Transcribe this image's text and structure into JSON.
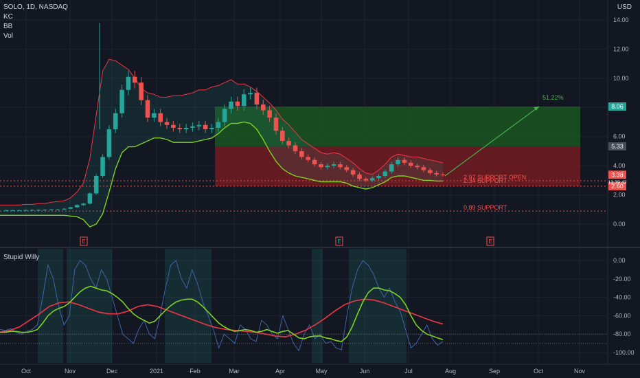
{
  "header": {
    "symbol": "SOLO, 1D, NASDAQ",
    "indicators": [
      "KC",
      "BB",
      "Vol"
    ],
    "currency": "USD"
  },
  "lower_pane": {
    "title": "Stupid Willy"
  },
  "colors": {
    "background": "#131722",
    "grid": "#1e2330",
    "up": "#26a69a",
    "down": "#ef5350",
    "green_line": "#4caf50",
    "red_line": "#f23645",
    "blue_line": "#3f63a8",
    "profit_zone": "#1b5e20",
    "loss_zone": "#7f1d21"
  },
  "chart_data": [
    {
      "type": "line",
      "name": "price",
      "title": "SOLO, 1D, NASDAQ",
      "y_axis_ticks": [
        14.0,
        12.0,
        10.0,
        8.0,
        6.0,
        4.0,
        2.0,
        0.0
      ],
      "ylim": [
        -0.4,
        15.2
      ],
      "x_labels": [
        "Oct",
        "Nov",
        "Dec",
        "2021",
        "Feb",
        "Mar",
        "Apr",
        "May",
        "Jun",
        "Jul",
        "Aug",
        "Sep",
        "Oct",
        "Nov"
      ],
      "price_badges": [
        {
          "label": "8.06",
          "value": 8.06,
          "color": "#26a69a"
        },
        {
          "label": "5.33",
          "value": 5.33,
          "color": "#4a4e5a"
        },
        {
          "label": "3.38",
          "value": 3.38,
          "color": "#ef5350"
        },
        {
          "label": "2.60",
          "value": 2.6,
          "color": "#ef5350"
        }
      ],
      "current_price_countdown": "13:39:42",
      "support_lines": [
        {
          "label": "2.97 SUPPORT OPEN",
          "value": 2.97
        },
        {
          "label": "2.34 SUPPORT",
          "value": 2.6
        },
        {
          "label": "0.89 SUPPORT",
          "value": 0.89
        }
      ],
      "target_percent": "51.22%",
      "position": {
        "entry": 5.33,
        "target": 8.06,
        "stop": 2.6
      },
      "earnings_markers": [
        "E",
        "E",
        "E"
      ],
      "close_series": [
        0.95,
        0.95,
        0.95,
        0.95,
        0.96,
        0.97,
        0.97,
        0.98,
        1.0,
        1.0,
        1.05,
        1.15,
        1.3,
        1.4,
        2.1,
        3.3,
        4.6,
        6.5,
        7.6,
        9.2,
        10.1,
        9.7,
        8.5,
        7.3,
        7.6,
        7.0,
        6.8,
        6.6,
        6.5,
        6.6,
        6.7,
        6.8,
        6.5,
        6.6,
        7.0,
        7.9,
        8.4,
        8.1,
        8.9,
        9.0,
        8.2,
        7.8,
        7.3,
        6.4,
        5.7,
        5.4,
        5.0,
        4.6,
        4.4,
        4.1,
        3.9,
        4.0,
        4.1,
        3.9,
        3.7,
        3.4,
        3.1,
        3.0,
        3.15,
        3.3,
        3.6,
        4.1,
        4.4,
        4.2,
        4.0,
        3.9,
        3.7,
        3.5,
        3.4,
        3.38
      ],
      "upper_band": [
        1.3,
        1.3,
        1.3,
        1.3,
        1.35,
        1.35,
        1.4,
        1.4,
        1.5,
        1.55,
        1.6,
        1.8,
        2.2,
        2.8,
        4.5,
        7.5,
        10.5,
        11.3,
        11.2,
        10.9,
        10.6,
        10.0,
        9.3,
        9.0,
        8.9,
        8.7,
        8.7,
        8.8,
        8.8,
        8.9,
        9.0,
        9.2,
        9.2,
        9.4,
        9.5,
        9.7,
        9.9,
        9.6,
        9.6,
        9.4,
        9.1,
        8.7,
        8.3,
        7.8,
        7.2,
        6.8,
        6.3,
        5.8,
        5.5,
        5.2,
        4.9,
        4.8,
        4.9,
        4.8,
        4.5,
        4.2,
        3.8,
        3.5,
        3.4,
        3.7,
        4.1,
        4.6,
        4.8,
        4.7,
        4.6,
        4.6,
        4.5,
        4.4,
        4.3,
        4.2
      ],
      "lower_band": [
        0.6,
        0.6,
        0.6,
        0.6,
        0.6,
        0.6,
        0.6,
        0.6,
        0.6,
        0.6,
        0.6,
        0.55,
        0.5,
        0.3,
        -0.2,
        0.0,
        0.7,
        2.2,
        3.8,
        4.9,
        5.3,
        5.3,
        5.5,
        5.7,
        5.9,
        5.9,
        5.8,
        5.6,
        5.6,
        5.6,
        5.6,
        5.7,
        5.8,
        5.9,
        6.2,
        6.6,
        6.9,
        6.9,
        7.0,
        6.9,
        6.5,
        5.8,
        5.0,
        4.3,
        3.8,
        3.5,
        3.3,
        3.2,
        3.1,
        3.0,
        2.9,
        2.9,
        2.9,
        2.9,
        2.8,
        2.6,
        2.5,
        2.4,
        2.5,
        2.7,
        2.9,
        3.2,
        3.3,
        3.3,
        3.2,
        3.1,
        3.0,
        3.0,
        2.95,
        2.95
      ]
    },
    {
      "type": "line",
      "name": "oscillator",
      "title": "Stupid Willy",
      "y_axis_ticks": [
        0.0,
        -20.0,
        -40.0,
        -60.0,
        -80.0,
        -100.0
      ],
      "ylim": [
        -103,
        3
      ],
      "x_labels": [
        "Oct",
        "Nov",
        "Dec",
        "2021",
        "Feb",
        "Mar",
        "Apr",
        "May",
        "Jun",
        "Jul",
        "Aug",
        "Sep",
        "Oct",
        "Nov"
      ],
      "fast_series": [
        -75,
        -76,
        -74,
        -78,
        -80,
        -77,
        -75,
        -70,
        -40,
        -5,
        -20,
        -50,
        -70,
        -60,
        -10,
        0,
        -5,
        -20,
        -30,
        -10,
        -20,
        -40,
        -60,
        -80,
        -85,
        -90,
        -75,
        -65,
        -80,
        -85,
        -60,
        -30,
        -5,
        0,
        -20,
        -30,
        -10,
        -25,
        -45,
        -60,
        -75,
        -95,
        -80,
        -85,
        -90,
        -70,
        -75,
        -85,
        -88,
        -65,
        -70,
        -80,
        -85,
        -60,
        -75,
        -90,
        -98,
        -80,
        -70,
        -85,
        -80,
        -90,
        -88,
        -95,
        -97,
        -60,
        -30,
        -10,
        0,
        -5,
        -15,
        -30,
        -40,
        -30,
        -45,
        -55,
        -75,
        -95,
        -90,
        -80,
        -70,
        -85,
        -92,
        -88
      ],
      "signal_series": [
        -78,
        -78,
        -77,
        -77,
        -78,
        -78,
        -77,
        -75,
        -68,
        -60,
        -55,
        -52,
        -50,
        -46,
        -40,
        -34,
        -30,
        -28,
        -30,
        -32,
        -33,
        -36,
        -40,
        -45,
        -52,
        -58,
        -62,
        -65,
        -68,
        -66,
        -60,
        -54,
        -49,
        -45,
        -43,
        -42,
        -42,
        -45,
        -50,
        -56,
        -62,
        -68,
        -72,
        -75,
        -77,
        -76,
        -75,
        -76,
        -78,
        -77,
        -75,
        -77,
        -79,
        -77,
        -76,
        -80,
        -84,
        -85,
        -83,
        -82,
        -82,
        -84,
        -85,
        -87,
        -88,
        -83,
        -72,
        -58,
        -45,
        -35,
        -30,
        -30,
        -32,
        -33,
        -36,
        -40,
        -48,
        -60,
        -70,
        -76,
        -80,
        -82,
        -84,
        -86
      ],
      "trend_series": [
        -78,
        -76,
        -72,
        -65,
        -58,
        -50,
        -46,
        -45,
        -48,
        -52,
        -56,
        -58,
        -58,
        -55,
        -50,
        -48,
        -50,
        -54,
        -58,
        -62,
        -66,
        -70,
        -73,
        -75,
        -76,
        -77,
        -78,
        -80,
        -82,
        -83,
        -80,
        -76,
        -70,
        -63,
        -55,
        -48,
        -44,
        -42,
        -43,
        -46,
        -50,
        -54,
        -58,
        -62,
        -66,
        -69
      ]
    }
  ]
}
